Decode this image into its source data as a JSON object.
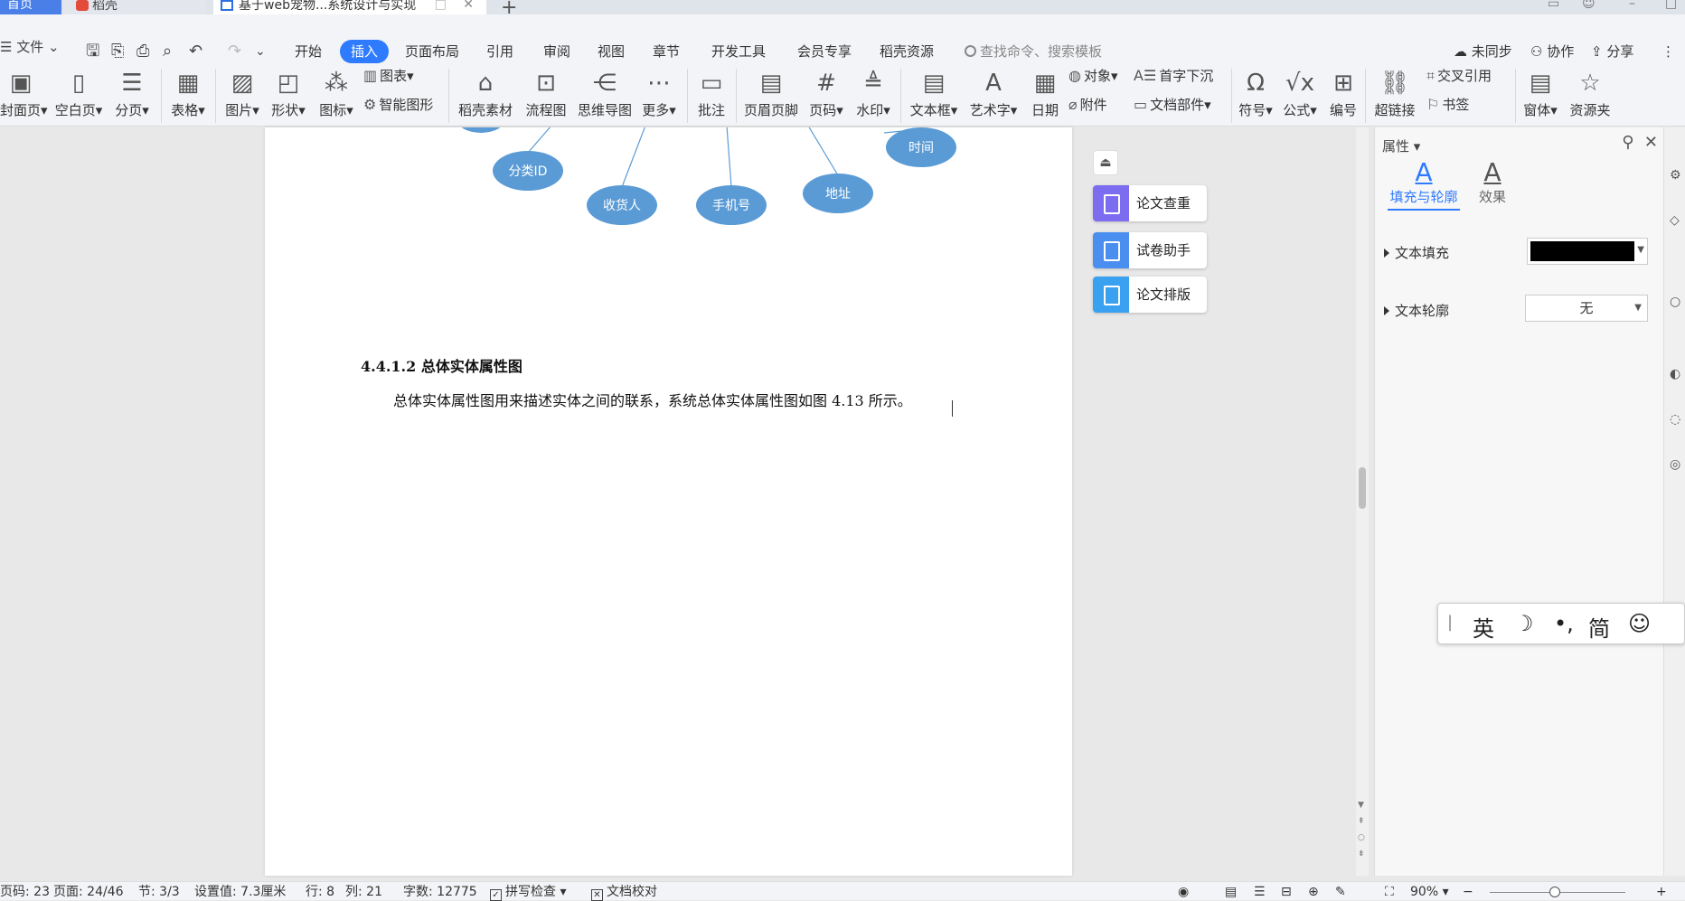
{
  "title_bar": {
    "tabs": [
      {
        "label": "首页"
      },
      {
        "label": "稻壳"
      },
      {
        "label": "基于web宠物...系统设计与实现"
      }
    ]
  },
  "menu": {
    "file_label": "文件",
    "items": [
      "开始",
      "插入",
      "页面布局",
      "引用",
      "审阅",
      "视图",
      "章节",
      "开发工具",
      "会员专享",
      "稻壳资源"
    ],
    "active": "插入",
    "search_placeholder": "查找命令、搜索模板",
    "right": [
      "未同步",
      "协作",
      "分享"
    ]
  },
  "ribbon": {
    "cover_page": "封面页",
    "blank_page": "空白页",
    "page_break": "分页",
    "table": "表格",
    "picture": "图片",
    "shape": "形状",
    "icon": "图标",
    "chart": "图表",
    "smart_graphic": "智能图形",
    "daoke_material": "稻壳素材",
    "flowchart": "流程图",
    "mindmap": "思维导图",
    "more": "更多",
    "comment": "批注",
    "header_footer": "页眉页脚",
    "page_number": "页码",
    "watermark": "水印",
    "textbox": "文本框",
    "wordart": "艺术字",
    "date": "日期",
    "object": "对象",
    "dropcap": "首字下沉",
    "attachment": "附件",
    "doc_parts": "文档部件",
    "symbol": "符号",
    "formula": "公式",
    "numbering": "编号",
    "hyperlink": "超链接",
    "cross_ref": "交叉引用",
    "bookmark": "书签",
    "window": "窗体",
    "resource": "资源夹"
  },
  "diagram": {
    "nodes": [
      "分类ID",
      "收货人",
      "手机号",
      "地址",
      "时间"
    ],
    "color": "#5b9bd5"
  },
  "document": {
    "heading": "4.4.1.2  总体实体属性图",
    "paragraph": "总体实体属性图用来描述实体之间的联系，系统总体实体属性图如图 4.13 所示。"
  },
  "assistant": {
    "buttons": [
      {
        "label": "论文查重",
        "color": "#7b6cf0"
      },
      {
        "label": "试卷助手",
        "color": "#4a8ef0"
      },
      {
        "label": "论文排版",
        "color": "#3aa0f0"
      }
    ]
  },
  "properties_panel": {
    "title": "属性",
    "tabs": [
      "填充与轮廓",
      "效果"
    ],
    "text_fill_label": "文本填充",
    "text_fill_color": "#000000",
    "text_outline_label": "文本轮廓",
    "text_outline_value": "无"
  },
  "ime_bar": {
    "items": [
      "英",
      "简"
    ]
  },
  "status_bar": {
    "page_code": "页码: 23",
    "page": "页面: 24/46",
    "section": "节: 3/3",
    "setting": "设置值: 7.3厘米",
    "row": "行: 8",
    "col": "列: 21",
    "word_count": "字数: 12775",
    "spell_check": "拼写检查",
    "doc_proof": "文档校对",
    "zoom": "90%"
  }
}
